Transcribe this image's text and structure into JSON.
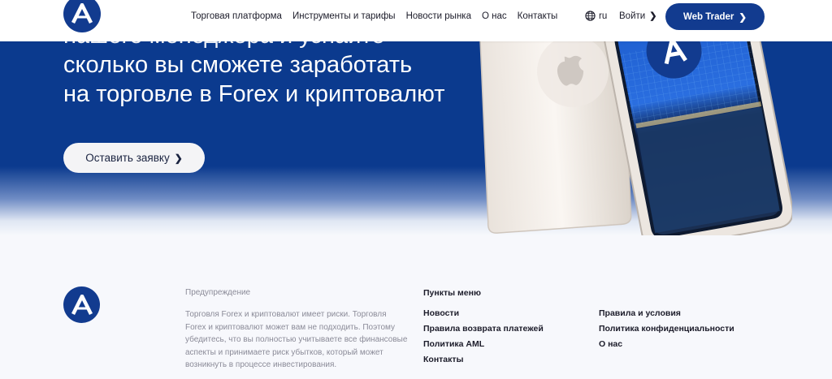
{
  "header": {
    "logo_alt": "A",
    "nav": [
      {
        "label": "Торговая платформа"
      },
      {
        "label": "Инструменты и тарифы"
      },
      {
        "label": "Новости рынка"
      },
      {
        "label": "О нас"
      },
      {
        "label": "Контакты"
      }
    ],
    "language": "ru",
    "login_label": "Войти",
    "webtrader_label": "Web Trader"
  },
  "hero": {
    "title_lines": [
      "нашего менеджера и узнайте",
      "сколько вы сможете заработать",
      "на торговле в Forex и криптовалют"
    ],
    "cta_label": "Оставить заявку"
  },
  "footer": {
    "warning_title": "Предупреждение",
    "warning_text": "Торговля Forex и криптовалют имеет риски. Торговля Forex и криптовалют может вам не подходить. Поэтому убедитесь, что вы полностью учитываете все финансовые аспекты и принимаете риск убытков, который может возникнуть в процессе инвестирования.",
    "menu_title": "Пункты меню",
    "menu_col1": [
      {
        "label": "Новости"
      },
      {
        "label": "Правила возврата платежей"
      },
      {
        "label": "Политика AML"
      },
      {
        "label": "Контакты"
      }
    ],
    "menu_col2": [
      {
        "label": "Правила и условия"
      },
      {
        "label": "Политика конфиденциальности"
      },
      {
        "label": "О нас"
      }
    ]
  },
  "colors": {
    "brand": "#123b8f",
    "hero_bg": "#0b3a8e",
    "page_bg": "#f7f8fc"
  },
  "icons": {
    "logo": "logo-a-icon",
    "globe": "globe-icon",
    "chevron": "chevron-right-icon"
  }
}
